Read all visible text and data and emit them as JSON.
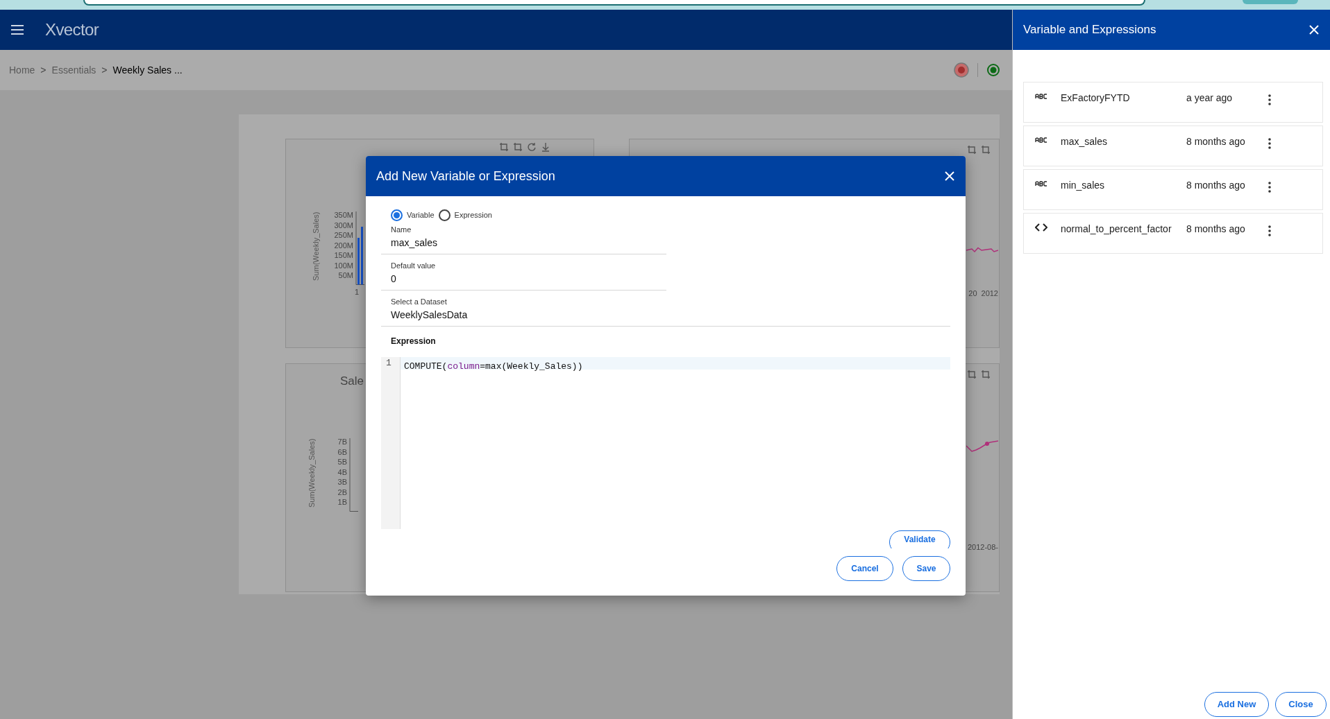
{
  "app_bar": {
    "logo": "Xvector"
  },
  "breadcrumb": {
    "items": [
      {
        "label": "Home",
        "current": false
      },
      {
        "label": "Essentials",
        "current": false
      },
      {
        "label": "Weekly Sales ...",
        "current": true
      }
    ],
    "separators": [
      ">",
      ">"
    ]
  },
  "dashboard": {
    "charts": [
      {
        "kind": "bars",
        "y_axis_label": "Sum(Weekly_Sales)",
        "y_ticks": [
          "350M",
          "300M",
          "250M",
          "200M",
          "150M",
          "100M",
          "50M"
        ],
        "x_ticks": [
          "1"
        ]
      },
      {
        "kind": "line",
        "x_ticks": [
          "20",
          "2012"
        ]
      },
      {
        "kind": "bars",
        "title": "Sale",
        "y_axis_label": "Sum(Weekly_Sales)",
        "y_ticks": [
          "7B",
          "6B",
          "5B",
          "4B",
          "3B",
          "2B",
          "1B"
        ]
      },
      {
        "kind": "line",
        "x_ticks": [
          "2012-08-"
        ]
      }
    ]
  },
  "dialog": {
    "title": "Add New Variable or Expression",
    "type_options": [
      {
        "label": "Variable",
        "selected": true
      },
      {
        "label": "Expression",
        "selected": false
      }
    ],
    "fields": [
      {
        "label": "Name",
        "value": "max_sales"
      },
      {
        "label": "Default value",
        "value": "0"
      },
      {
        "label": "Select a Dataset",
        "value": "WeeklySalesData"
      }
    ],
    "expression_label": "Expression",
    "code_lines": [
      {
        "number": "1",
        "tokens": [
          {
            "text": "COMPUTE(",
            "kind": "plain"
          },
          {
            "text": "column",
            "kind": "keyword"
          },
          {
            "text": "=max(Weekly_Sales))",
            "kind": "plain"
          }
        ]
      }
    ],
    "validate_button": "Validate",
    "buttons": [
      "Cancel",
      "Save"
    ]
  },
  "side_panel": {
    "title": "Variable and Expressions",
    "items": [
      {
        "kind": "text",
        "name": "ExFactoryFYTD",
        "updated": "a year ago"
      },
      {
        "kind": "text",
        "name": "max_sales",
        "updated": "8 months ago"
      },
      {
        "kind": "text",
        "name": "min_sales",
        "updated": "8 months ago"
      },
      {
        "kind": "expression",
        "name": "normal_to_percent_factor",
        "updated": "8 months ago"
      }
    ],
    "buttons": [
      "Add New",
      "Close"
    ]
  }
}
